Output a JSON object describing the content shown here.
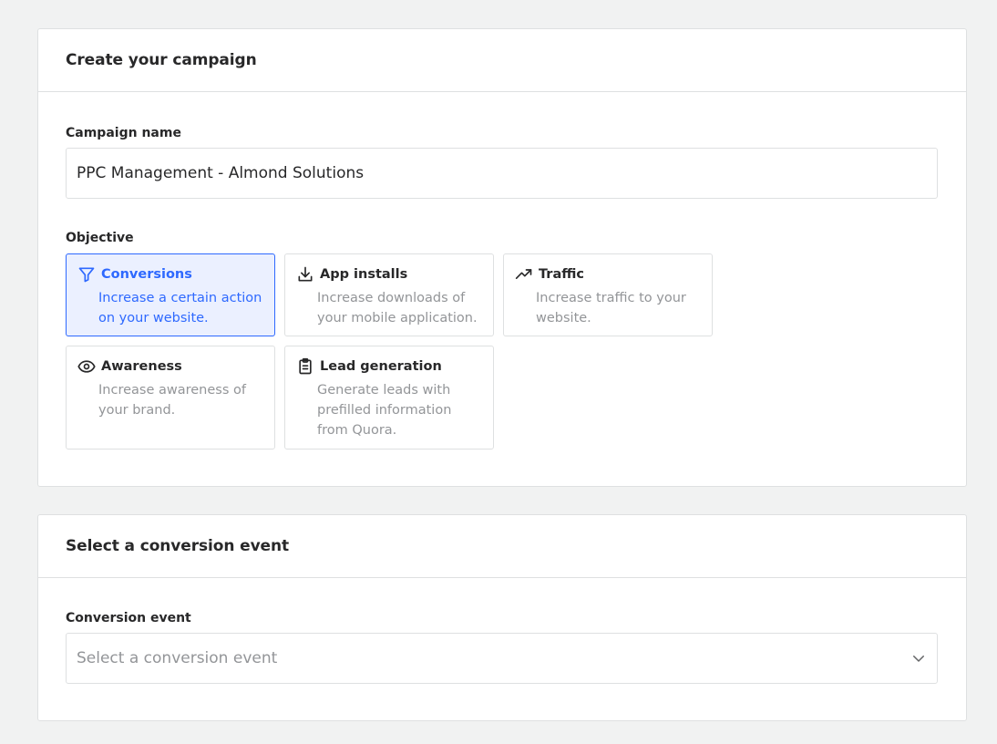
{
  "campaign_card": {
    "title": "Create your campaign",
    "name_label": "Campaign name",
    "name_value": "PPC Management - Almond Solutions",
    "objective_label": "Objective",
    "objectives": [
      {
        "title": "Conversions",
        "description": "Increase a certain action on your website.",
        "icon": "filter-icon",
        "selected": true
      },
      {
        "title": "App installs",
        "description": "Increase downloads of your mobile application.",
        "icon": "download-icon",
        "selected": false
      },
      {
        "title": "Traffic",
        "description": "Increase traffic to your website.",
        "icon": "trending-up-icon",
        "selected": false
      },
      {
        "title": "Awareness",
        "description": "Increase awareness of your brand.",
        "icon": "eye-icon",
        "selected": false
      },
      {
        "title": "Lead generation",
        "description": "Generate leads with prefilled information from Quora.",
        "icon": "clipboard-icon",
        "selected": false
      }
    ]
  },
  "conversion_card": {
    "title": "Select a conversion event",
    "event_label": "Conversion event",
    "event_placeholder": "Select a conversion event",
    "chevron_icon": "chevron-down-icon"
  },
  "colors": {
    "accent": "#2e69ff",
    "selected_bg": "#ebf0ff",
    "text": "#282829",
    "muted_text": "#939598",
    "border": "#dee0e1",
    "page_bg": "#f1f2f2"
  }
}
